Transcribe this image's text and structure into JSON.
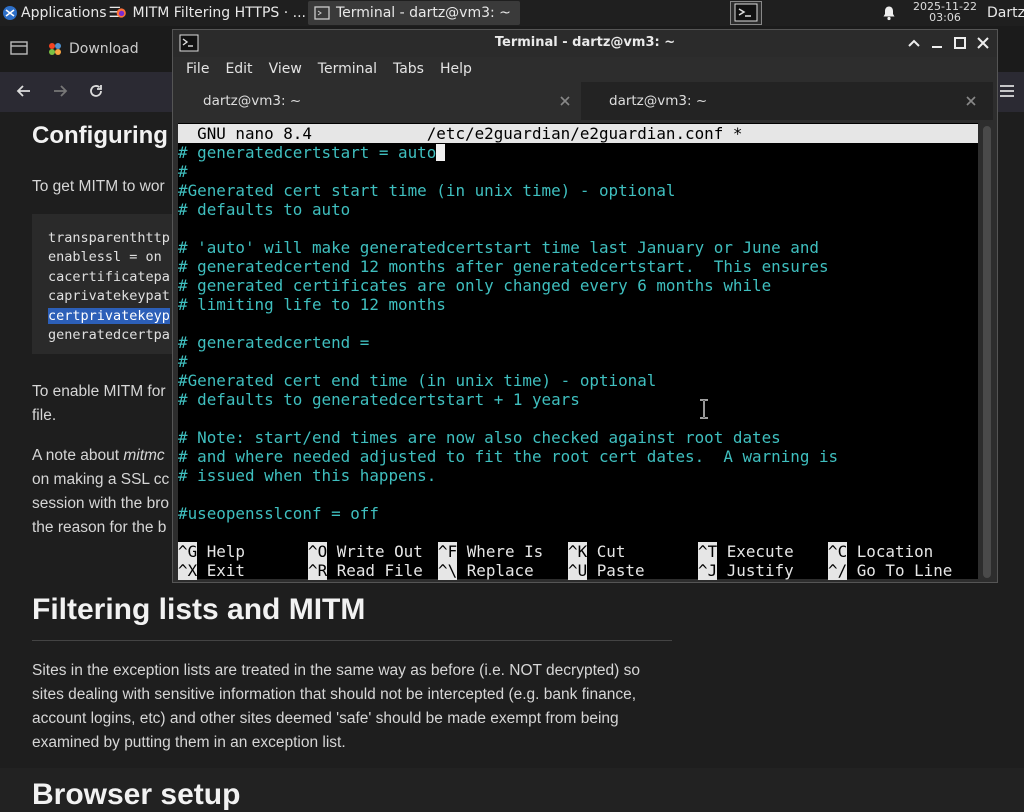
{
  "topbar": {
    "apps_label": "Applications",
    "tasks": [
      {
        "label": "MITM Filtering HTTPS · ...",
        "icon": "firefox-icon"
      },
      {
        "label": "Terminal - dartz@vm3: ~",
        "icon": "terminal-icon"
      }
    ],
    "clock_date": "2025-11-22",
    "clock_time": "03:06",
    "user": "Dartz"
  },
  "browser": {
    "tab_label": "Download",
    "page": {
      "heading1": "Configuring",
      "intro": "To get MITM to wor",
      "code_lines": [
        "transparenthttp",
        "enablessl = on",
        "cacertificatepa",
        "caprivatekeypat",
        "certprivatekeyp",
        "generatedcertpa"
      ],
      "para2_line1": "To enable MITM for",
      "para2_line2": "file.",
      "para3_line1a": "A note about ",
      "para3_line1b": "mitmc",
      "para3_line2": "on making a SSL cc",
      "para3_line3": "session with the bro",
      "para3_line4": "the reason for the b",
      "heading2": "Filtering lists and MITM",
      "para4": [
        "Sites in the exception lists are treated in the same way as before (i.e. NOT decrypted) so",
        "sites dealing with sensitive information that should not be intercepted (e.g. bank finance,",
        "account logins, etc) and other sites deemed 'safe' should be made exempt from being",
        "examined by putting them in an exception list."
      ],
      "heading3": "Browser setup"
    }
  },
  "terminal": {
    "title": "Terminal - dartz@vm3: ~",
    "menu": [
      "File",
      "Edit",
      "View",
      "Terminal",
      "Tabs",
      "Help"
    ],
    "tabs": [
      "dartz@vm3: ~",
      "dartz@vm3: ~"
    ],
    "nano": {
      "header": "  GNU nano 8.4            /etc/e2guardian/e2guardian.conf *",
      "lines": [
        "# generatedcertstart = auto",
        "#",
        "#Generated cert start time (in unix time) - optional",
        "# defaults to auto",
        "",
        "# 'auto' will make generatedcertstart time last January or June and",
        "# generatedcertend 12 months after generatedcertstart.  This ensures",
        "# generated certificates are only changed every 6 months while",
        "# limiting life to 12 months",
        "",
        "# generatedcertend =",
        "#",
        "#Generated cert end time (in unix time) - optional",
        "# defaults to generatedcertstart + 1 years",
        "",
        "# Note: start/end times are now also checked against root dates",
        "# and where needed adjusted to fit the root cert dates.  A warning is",
        "# issued when this happens.",
        "",
        "#useopensslconf = off"
      ],
      "shortcuts_row1": [
        {
          "key": "^G",
          "label": " Help"
        },
        {
          "key": "^O",
          "label": " Write Out"
        },
        {
          "key": "^F",
          "label": " Where Is"
        },
        {
          "key": "^K",
          "label": " Cut"
        },
        {
          "key": "^T",
          "label": " Execute"
        },
        {
          "key": "^C",
          "label": " Location"
        }
      ],
      "shortcuts_row2": [
        {
          "key": "^X",
          "label": " Exit"
        },
        {
          "key": "^R",
          "label": " Read File"
        },
        {
          "key": "^\\",
          "label": " Replace"
        },
        {
          "key": "^U",
          "label": " Paste"
        },
        {
          "key": "^J",
          "label": " Justify"
        },
        {
          "key": "^/",
          "label": " Go To Line"
        }
      ]
    }
  },
  "colors": {
    "nano_text": "#3fbfbf",
    "nano_bar": "#e6e6e6",
    "selection": "#2c5fb8"
  }
}
